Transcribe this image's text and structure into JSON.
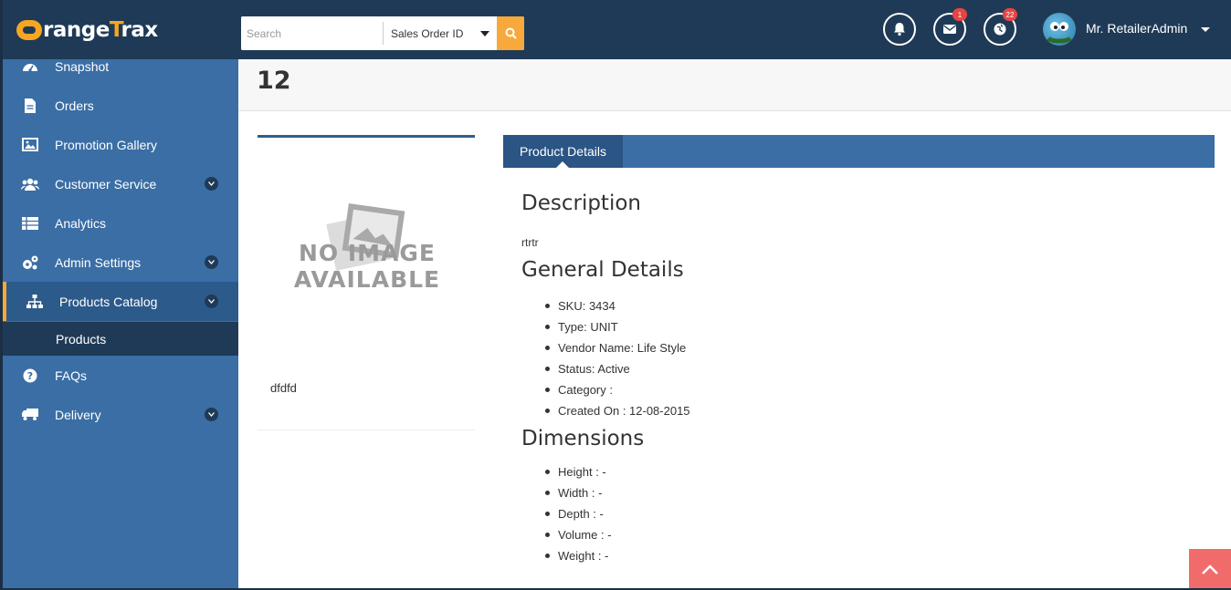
{
  "header": {
    "logo_text_white": "range",
    "logo_text_orange": "T",
    "logo_text_tail": "rax",
    "search_placeholder": "Search",
    "search_type_selected": "Sales Order ID",
    "messages_badge": "1",
    "globe_badge": "22",
    "user_name": "Mr. RetailerAdmin"
  },
  "sidebar": {
    "items": [
      {
        "label": "Snapshot",
        "icon": "dashboard-icon"
      },
      {
        "label": "Orders",
        "icon": "document-icon"
      },
      {
        "label": "Promotion Gallery",
        "icon": "image-icon"
      },
      {
        "label": "Customer Service",
        "icon": "users-icon"
      },
      {
        "label": "Analytics",
        "icon": "table-icon"
      },
      {
        "label": "Admin Settings",
        "icon": "gears-icon"
      },
      {
        "label": "Products Catalog",
        "icon": "sitemap-icon"
      },
      {
        "label": "FAQs",
        "icon": "question-icon"
      },
      {
        "label": "Delivery",
        "icon": "truck-icon"
      }
    ],
    "sub_item_label": "Products"
  },
  "page": {
    "title": "12"
  },
  "product_card": {
    "noimage_line1": "NO IMAGE",
    "noimage_line2": "AVAILABLE",
    "caption": "dfdfd"
  },
  "tabs": {
    "active_label": "Product Details"
  },
  "details": {
    "description_heading": "Description",
    "description_text": "rtrtr",
    "general_heading": "General Details",
    "general_items": [
      "SKU: 3434",
      "Type: UNIT",
      "Vendor Name: Life Style",
      "Status: Active",
      "Category :",
      "Created On : 12-08-2015"
    ],
    "dimensions_heading": "Dimensions",
    "dimension_items": [
      "Height : -",
      "Width : -",
      "Depth : -",
      "Volume : -",
      "Weight : -"
    ]
  },
  "colors": {
    "topbar": "#1f3a56",
    "sidebar": "#3a6ea5",
    "accent": "#f7a93b",
    "badge": "#e64444",
    "scroll_top": "#f16b6b"
  }
}
